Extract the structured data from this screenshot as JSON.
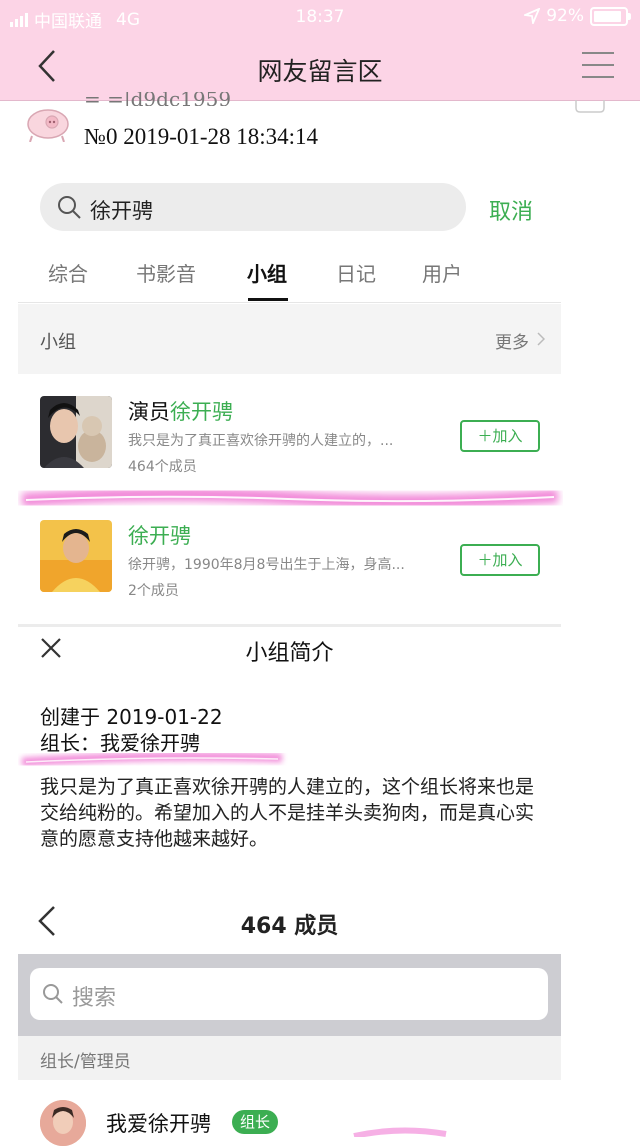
{
  "status": {
    "carrier": "中国联通",
    "network": "4G",
    "time": "18:37",
    "battery": "92%"
  },
  "nav": {
    "title": "网友留言区"
  },
  "message": {
    "user": "= =|d9dc1959",
    "meta": "№0   2019-01-28 18:34:14"
  },
  "search": {
    "query": "徐开骋",
    "cancel": "取消"
  },
  "tabs": [
    "综合",
    "书影音",
    "小组",
    "日记",
    "用户"
  ],
  "active_tab": "小组",
  "groups_section": {
    "label": "小组",
    "more": "更多"
  },
  "groups": [
    {
      "name_prefix": "演员",
      "name_highlight": "徐开骋",
      "desc": "我只是为了真正喜欢徐开骋的人建立的，...",
      "count": "464个成员",
      "join": "加入"
    },
    {
      "name_prefix": "",
      "name_highlight": "徐开骋",
      "desc": "徐开骋，1990年8月8号出生于上海，身高...",
      "count": "2个成员",
      "join": "加入"
    }
  ],
  "intro": {
    "title": "小组简介",
    "created": "创建于 2019-01-22",
    "leader": "组长：我爱徐开骋",
    "body": "我只是为了真正喜欢徐开骋的人建立的，这个组长将来也是交给纯粉的。希望加入的人不是挂羊头卖狗肉，而是真心实意的愿意支持他越来越好。"
  },
  "members": {
    "title": "464 成员",
    "search_placeholder": "搜索",
    "section": "组长/管理员",
    "first": {
      "name": "我爱徐开骋",
      "badge": "组长"
    }
  },
  "colors": {
    "nav_pink": "#fcd4e6",
    "accent_green": "#3cae52",
    "highlight_pink": "#f07cd4"
  }
}
